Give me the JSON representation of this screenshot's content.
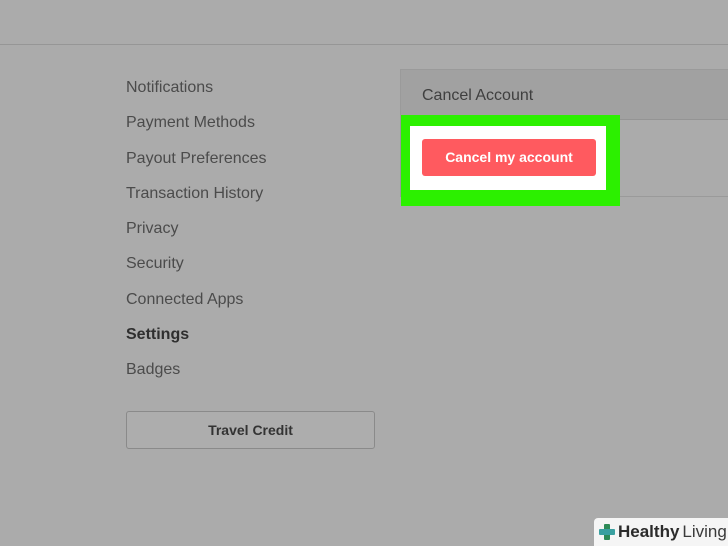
{
  "sidebar": {
    "items": [
      {
        "label": "Notifications"
      },
      {
        "label": "Payment Methods"
      },
      {
        "label": "Payout Preferences"
      },
      {
        "label": "Transaction History"
      },
      {
        "label": "Privacy"
      },
      {
        "label": "Security"
      },
      {
        "label": "Connected Apps"
      },
      {
        "label": "Settings"
      },
      {
        "label": "Badges"
      }
    ],
    "active_item": "Settings",
    "travel_credit_label": "Travel Credit"
  },
  "panel": {
    "title": "Cancel Account",
    "cancel_button_label": "Cancel my account"
  },
  "watermark": {
    "word1": "Healthy",
    "word2": "Living"
  },
  "colors": {
    "background": "#ababab",
    "cancel_button": "#ff5a5f",
    "highlight": "#2cf000"
  }
}
